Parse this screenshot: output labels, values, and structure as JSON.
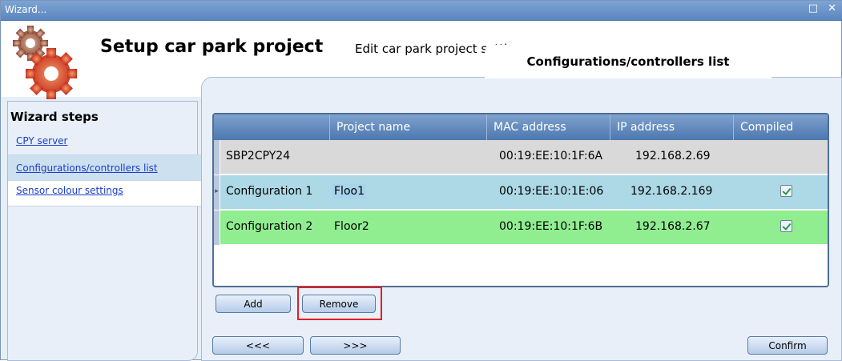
{
  "window": {
    "title": "Wizard...",
    "controls": "□ ✕"
  },
  "header": {
    "title": "Setup car park project",
    "subtitle": "Edit car park project settings",
    "logo_icon": "gears-icon",
    "active_tab": "Configurations/controllers list"
  },
  "wizard_steps": {
    "title": "Wizard steps",
    "items": [
      {
        "label": "CPY server",
        "selected": false
      },
      {
        "label": "Configurations/controllers list",
        "selected": true
      },
      {
        "label": "Sensor colour settings",
        "selected": false
      }
    ]
  },
  "grid": {
    "columns": [
      "",
      "Project name",
      "MAC address",
      "IP address",
      "Compiled"
    ],
    "rows": [
      {
        "name": "SBP2CPY24",
        "project": "",
        "mac": "00:19:EE:10:1F:6A",
        "ip": "192.168.2.69",
        "compiled": null,
        "color": "#d9d9d9"
      },
      {
        "name": "Configuration 1",
        "project": "Floo1",
        "mac": "00:19:EE:10:1E:06",
        "ip": "192.168.2.169",
        "compiled": true,
        "color": "#add8e6",
        "current": true
      },
      {
        "name": "Configuration 2",
        "project": "Floor2",
        "mac": "00:19:EE:10:1F:6B",
        "ip": "192.168.2.67",
        "compiled": true,
        "color": "#90ee90"
      }
    ]
  },
  "buttons": {
    "add": "Add",
    "remove": "Remove",
    "back": "<<<",
    "next": ">>>",
    "confirm": "Confirm"
  },
  "colors": {
    "highlight": "#e31e24",
    "header_grad_top": "#7fa1cd",
    "header_grad_bottom": "#4c78b0"
  }
}
